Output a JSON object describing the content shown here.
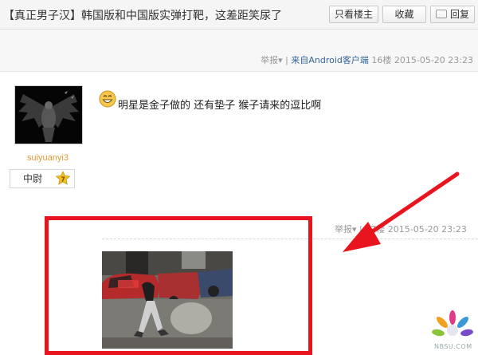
{
  "header": {
    "title": "【真正男子汉】韩国版和中国版实弹打靶，这差距笑尿了",
    "buttons": {
      "only_author": "只看楼主",
      "favorite": "收藏",
      "reply": "回复"
    }
  },
  "post_meta_top": {
    "report": "举报",
    "report_caret": "▾",
    "divider": "|",
    "source": "来自Android客户端",
    "floor": "16楼",
    "time": "2015-05-20 23:23"
  },
  "author": {
    "username": "suiyuanyi3",
    "rank_title": "中尉",
    "level": "7"
  },
  "post": {
    "text": "明星是金子做的 还有垫子 猴子请来的逗比啊"
  },
  "post_meta_bottom": {
    "report": "举报",
    "report_caret": "▾",
    "divider": "|",
    "floor": "17楼",
    "time": "2015-05-20 23:23"
  },
  "watermark": {
    "text": "NBSU.COM"
  },
  "colors": {
    "highlight_red": "#e8141e",
    "username": "#e09a3a",
    "link_blue": "#336699"
  }
}
